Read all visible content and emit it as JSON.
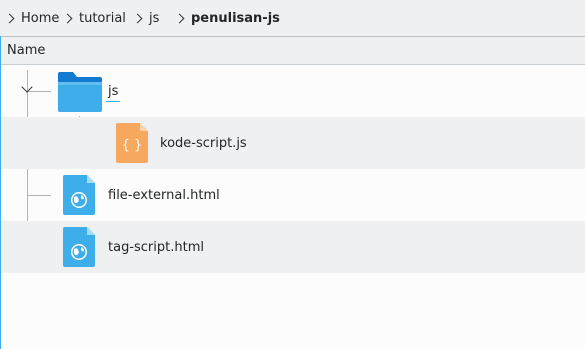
{
  "breadcrumb": {
    "items": [
      {
        "label": "Home"
      },
      {
        "label": "tutorial"
      },
      {
        "label": "js"
      },
      {
        "label": "penulisan-js"
      }
    ]
  },
  "columns": {
    "name_header": "Name"
  },
  "tree": {
    "folder": {
      "name": "js",
      "expanded": true,
      "icon": "folder-icon"
    },
    "children": [
      {
        "name": "kode-script.js",
        "icon": "javascript-file-icon"
      }
    ],
    "files": [
      {
        "name": "file-external.html",
        "icon": "html-file-icon"
      },
      {
        "name": "tag-script.html",
        "icon": "html-file-icon"
      }
    ]
  },
  "colors": {
    "accent": "#3daee9",
    "folder": "#1d99f3",
    "js_file": "#f4a661",
    "html_file": "#3daee9"
  }
}
